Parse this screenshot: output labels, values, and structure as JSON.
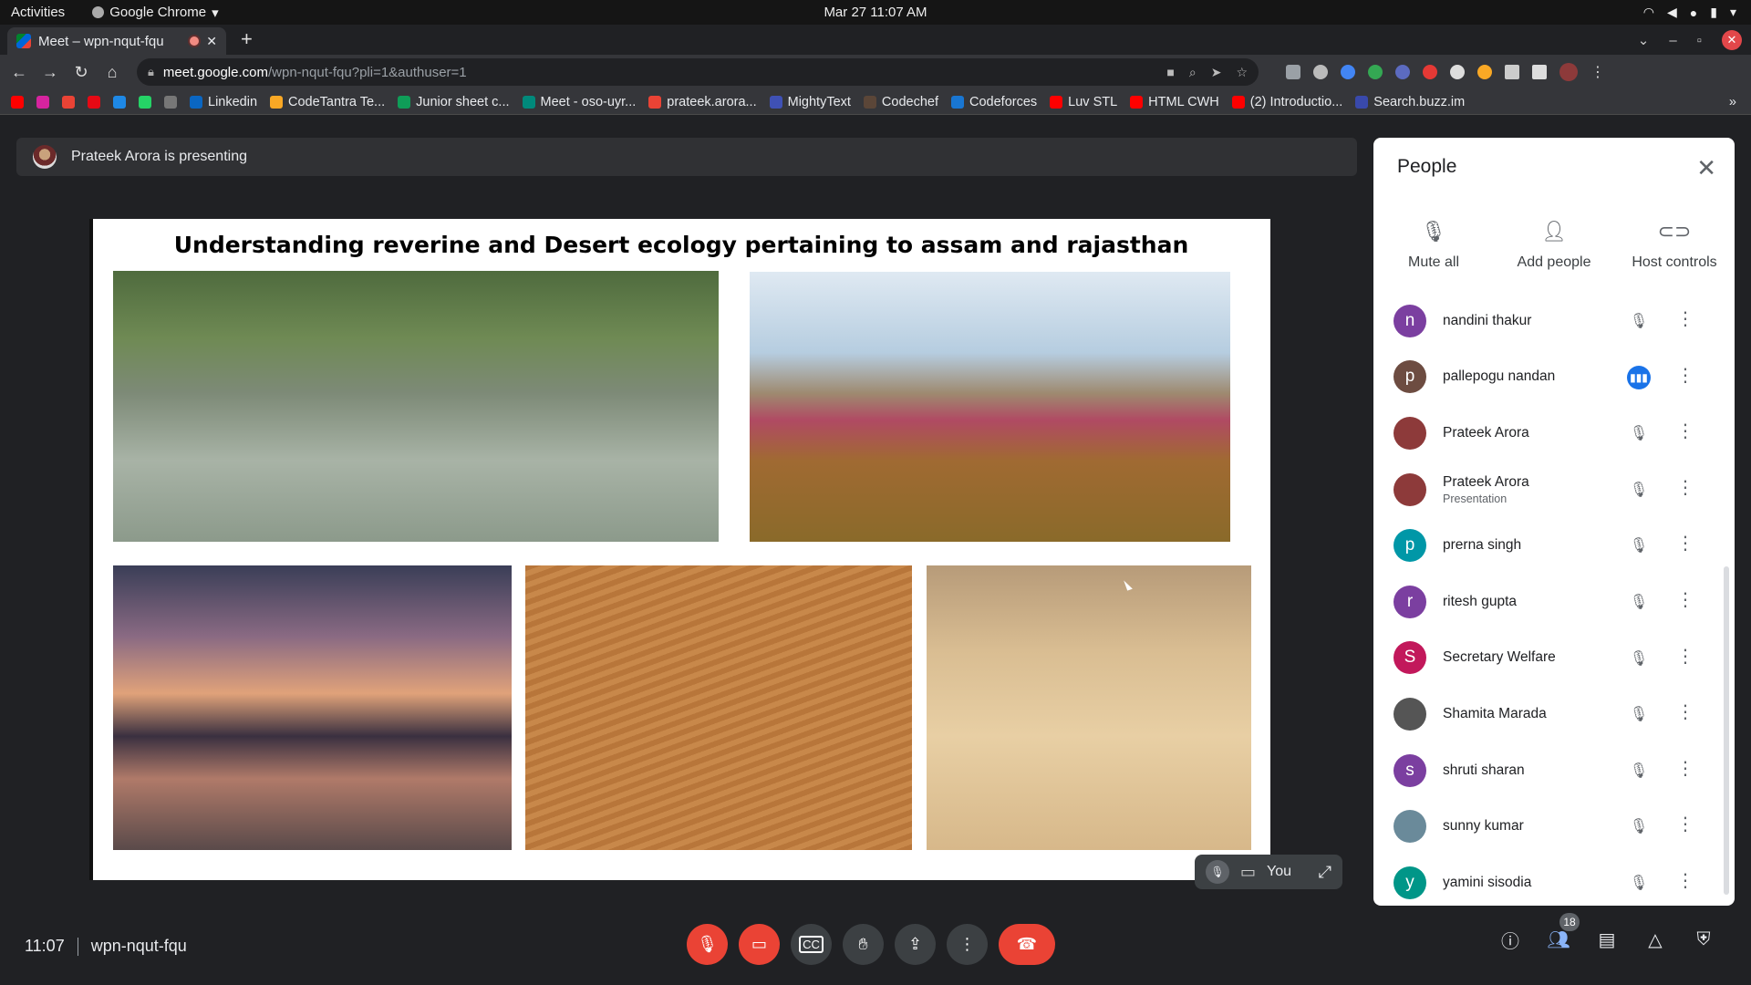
{
  "system": {
    "activities": "Activities",
    "app_name": "Google Chrome",
    "clock": "Mar 27  11:07 AM"
  },
  "browser": {
    "tab_title": "Meet – wpn-nqut-fqu",
    "url_host": "meet.google.com",
    "url_path": "/wpn-nqut-fqu?pli=1&authuser=1",
    "bookmarks": [
      {
        "label": "",
        "color": "#ff0000"
      },
      {
        "label": "",
        "color": "#d6249f"
      },
      {
        "label": "",
        "color": "#ea4335"
      },
      {
        "label": "",
        "color": "#e50914"
      },
      {
        "label": "",
        "color": "#1e88e5"
      },
      {
        "label": "",
        "color": "#25d366"
      },
      {
        "label": "",
        "color": "#777777"
      },
      {
        "label": "Linkedin",
        "color": "#0a66c2"
      },
      {
        "label": "CodeTantra Te...",
        "color": "#f9a825"
      },
      {
        "label": "Junior sheet c...",
        "color": "#0f9d58"
      },
      {
        "label": "Meet - oso-uyr...",
        "color": "#00897b"
      },
      {
        "label": "prateek.arora...",
        "color": "#ea4335"
      },
      {
        "label": "MightyText",
        "color": "#3f51b5"
      },
      {
        "label": "Codechef",
        "color": "#5b4638"
      },
      {
        "label": "Codeforces",
        "color": "#1976d2"
      },
      {
        "label": "Luv STL",
        "color": "#ff0000"
      },
      {
        "label": "HTML CWH",
        "color": "#ff0000"
      },
      {
        "label": "(2) Introductio...",
        "color": "#ff0000"
      },
      {
        "label": "Search.buzz.im",
        "color": "#3949ab"
      }
    ]
  },
  "meet": {
    "presenting_text": "Prateek Arora is presenting",
    "slide_title": "Understanding reverine and Desert ecology pertaining to assam and rajasthan",
    "self_tile_label": "You",
    "time": "11:07",
    "meeting_code": "wpn-nqut-fqu",
    "people_count_badge": "18"
  },
  "people_panel": {
    "title": "People",
    "actions": [
      {
        "label": "Mute all",
        "icon": "mic-off-icon"
      },
      {
        "label": "Add people",
        "icon": "add-person-icon"
      },
      {
        "label": "Host controls",
        "icon": "toggle-icon"
      }
    ],
    "participants": [
      {
        "initial": "n",
        "name": "nandini thakur",
        "sub": "",
        "color": "#7b3fa0",
        "speaking": false
      },
      {
        "initial": "p",
        "name": "pallepogu nandan",
        "sub": "",
        "color": "#6d4c41",
        "speaking": true
      },
      {
        "initial": "",
        "name": "Prateek Arora",
        "sub": "",
        "color": "#8d3a3a",
        "speaking": false
      },
      {
        "initial": "",
        "name": "Prateek Arora",
        "sub": "Presentation",
        "color": "#8d3a3a",
        "speaking": false
      },
      {
        "initial": "p",
        "name": "prerna singh",
        "sub": "",
        "color": "#0097a7",
        "speaking": false
      },
      {
        "initial": "r",
        "name": "ritesh gupta",
        "sub": "",
        "color": "#7b3fa0",
        "speaking": false
      },
      {
        "initial": "S",
        "name": "Secretary Welfare",
        "sub": "",
        "color": "#c2185b",
        "speaking": false
      },
      {
        "initial": "",
        "name": "Shamita Marada",
        "sub": "",
        "color": "#555555",
        "speaking": false
      },
      {
        "initial": "s",
        "name": "shruti sharan",
        "sub": "",
        "color": "#7b3fa0",
        "speaking": false
      },
      {
        "initial": "",
        "name": "sunny kumar",
        "sub": "",
        "color": "#6a8a9a",
        "speaking": false
      },
      {
        "initial": "y",
        "name": "yamini sisodia",
        "sub": "",
        "color": "#009688",
        "speaking": false
      }
    ]
  }
}
